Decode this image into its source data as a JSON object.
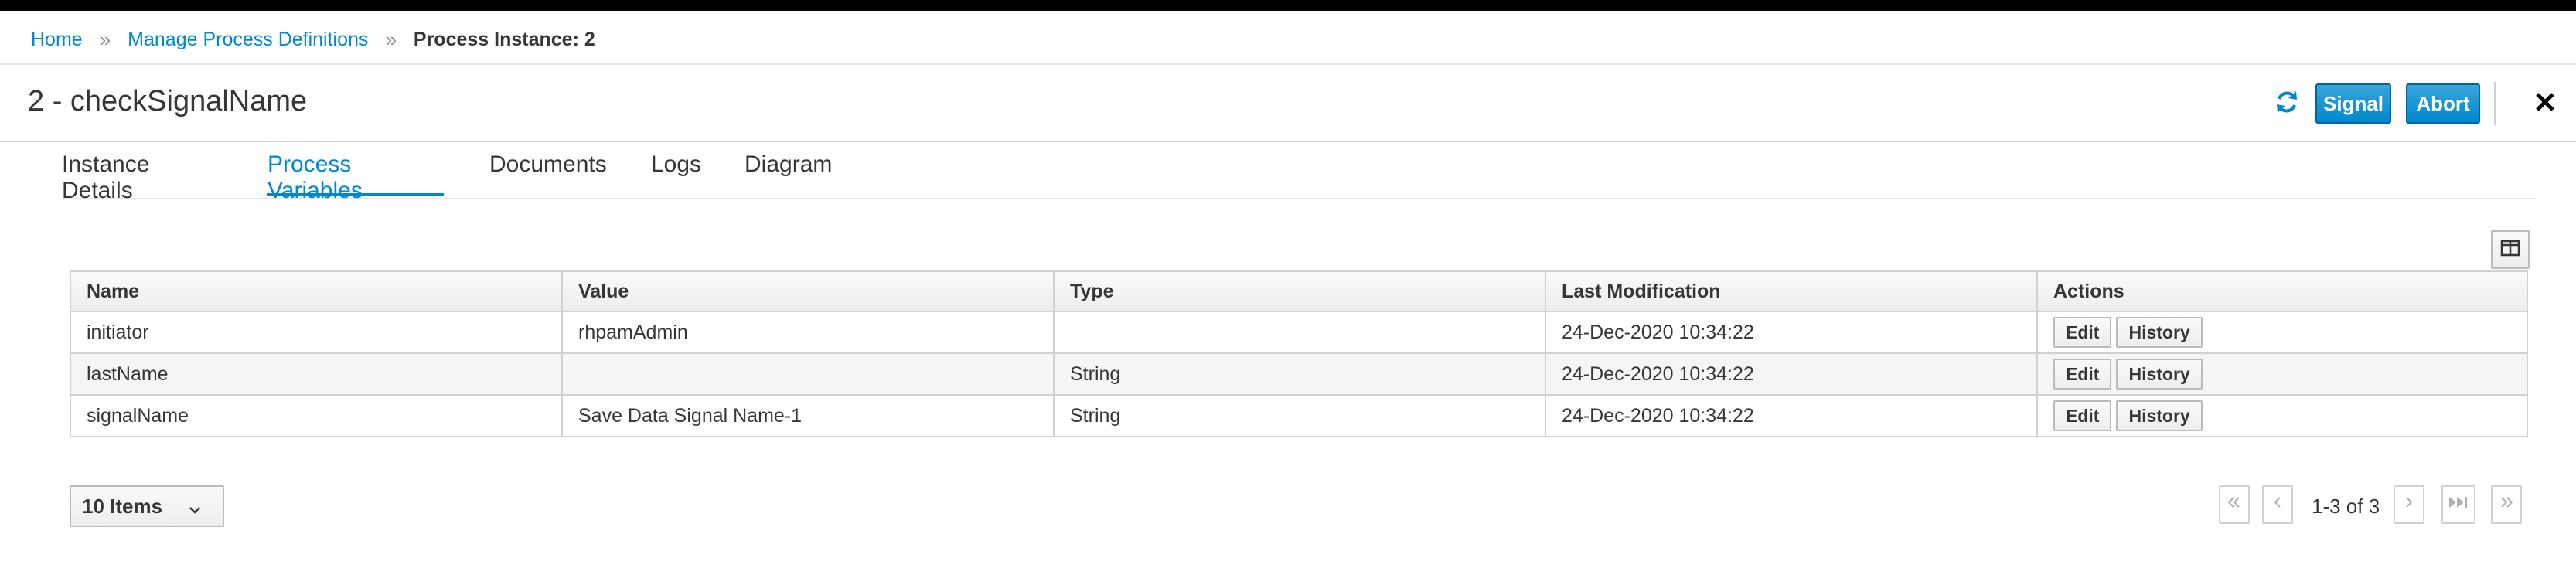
{
  "breadcrumb": {
    "items": [
      {
        "label": "Home"
      },
      {
        "label": "Manage Process Definitions"
      },
      {
        "label": "Process Instance: 2"
      }
    ],
    "separator": "»"
  },
  "header": {
    "title": "2 - checkSignalName",
    "signal_label": "Signal",
    "abort_label": "Abort"
  },
  "tabs": [
    {
      "label": "Instance Details",
      "active": false
    },
    {
      "label": "Process Variables",
      "active": true
    },
    {
      "label": "Documents",
      "active": false
    },
    {
      "label": "Logs",
      "active": false
    },
    {
      "label": "Diagram",
      "active": false
    }
  ],
  "table": {
    "columns": [
      "Name",
      "Value",
      "Type",
      "Last Modification",
      "Actions"
    ],
    "rows": [
      {
        "name": "initiator",
        "value": "rhpamAdmin",
        "type": "",
        "last_modification": "24-Dec-2020 10:34:22",
        "edit": "Edit",
        "history": "History"
      },
      {
        "name": "lastName",
        "value": "",
        "type": "String",
        "last_modification": "24-Dec-2020 10:34:22",
        "edit": "Edit",
        "history": "History"
      },
      {
        "name": "signalName",
        "value": "Save Data Signal Name-1",
        "type": "String",
        "last_modification": "24-Dec-2020 10:34:22",
        "edit": "Edit",
        "history": "History"
      }
    ]
  },
  "pagination": {
    "page_size": "10 Items",
    "info": "1-3 of 3"
  },
  "icons": {
    "refresh": "refresh-icon",
    "close": "close-icon",
    "columns": "columns-icon"
  },
  "colors": {
    "accent": "#0088ce",
    "primary_button": "#39a5dc"
  }
}
